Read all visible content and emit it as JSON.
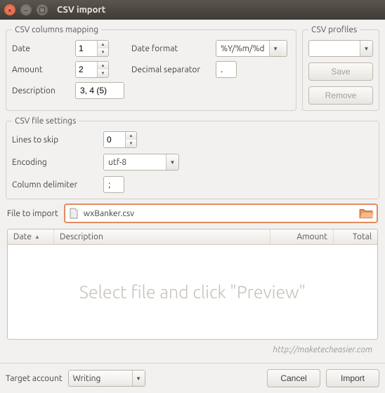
{
  "window": {
    "title": "CSV import"
  },
  "mapping": {
    "legend": "CSV columns mapping",
    "date_label": "Date",
    "date_value": "1",
    "amount_label": "Amount",
    "amount_value": "2",
    "description_label": "Description",
    "description_value": "3, 4 (5)",
    "dateformat_label": "Date format",
    "dateformat_value": "%Y/%m/%d",
    "decimal_label": "Decimal separator",
    "decimal_value": "."
  },
  "profiles": {
    "legend": "CSV profiles",
    "selected": "",
    "save_label": "Save",
    "remove_label": "Remove"
  },
  "settings": {
    "legend": "CSV file settings",
    "lines_label": "Lines to skip",
    "lines_value": "0",
    "encoding_label": "Encoding",
    "encoding_value": "utf-8",
    "delimiter_label": "Column delimiter",
    "delimiter_value": ";"
  },
  "file": {
    "label": "File to import",
    "value": "wxBanker.csv"
  },
  "preview": {
    "headers": {
      "date": "Date",
      "description": "Description",
      "amount": "Amount",
      "total": "Total"
    },
    "placeholder": "Select file and click \"Preview\""
  },
  "watermark": "http://maketecheasier.com",
  "footer": {
    "target_label": "Target account",
    "target_value": "Writing",
    "cancel": "Cancel",
    "import": "Import"
  }
}
